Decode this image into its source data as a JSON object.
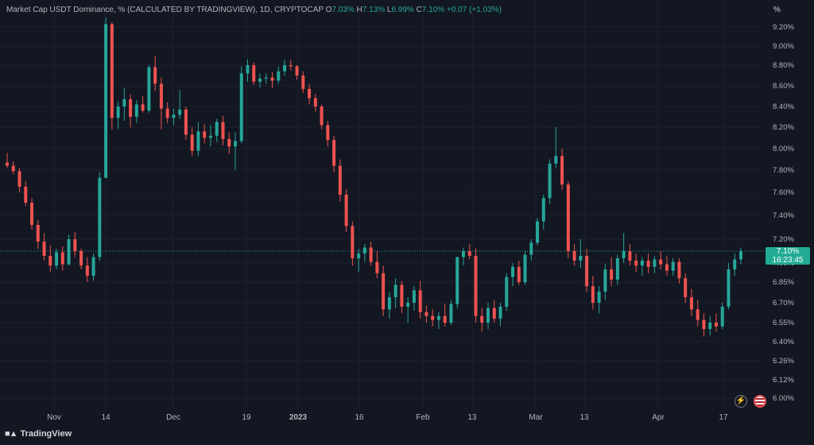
{
  "legend": {
    "title": "Market Cap USDT Dominance, % (CALCULATED BY TRADINGVIEW), 1D, CRYPTOCAP",
    "o_label": "O",
    "o_val": "7.03%",
    "h_label": "H",
    "h_val": "7.13%",
    "l_label": "L",
    "l_val": "6.99%",
    "c_label": "C",
    "c_val": "7.10%",
    "change": "+0.07 (+1.03%)"
  },
  "price_axis_unit": "%",
  "last_price": "7.10%",
  "countdown": "16:23:45",
  "brand": "TradingView",
  "colors": {
    "up": "#26a69a",
    "down": "#ef5350",
    "bg": "#131722",
    "grid": "#1e222d",
    "last": "#22ab94"
  },
  "icons": {
    "lightning": "lightning-icon",
    "flag": "us-flag-icon"
  },
  "chart_data": {
    "type": "candlestick",
    "y_ticks": [
      "9.20%",
      "9.00%",
      "8.80%",
      "8.60%",
      "8.40%",
      "8.20%",
      "8.00%",
      "7.80%",
      "7.60%",
      "7.40%",
      "7.20%",
      "7.00%",
      "6.85%",
      "6.70%",
      "6.55%",
      "6.40%",
      "6.26%",
      "6.12%",
      "6.00%"
    ],
    "x_ticks": [
      "Nov",
      "14",
      "Dec",
      "19",
      "2023",
      "16",
      "Feb",
      "13",
      "Mar",
      "13",
      "Apr",
      "17"
    ],
    "last_value": 7.1,
    "ohlc": [
      [
        7.87,
        7.96,
        7.82,
        7.84
      ],
      [
        7.84,
        7.88,
        7.76,
        7.79
      ],
      [
        7.79,
        7.82,
        7.6,
        7.65
      ],
      [
        7.65,
        7.7,
        7.48,
        7.51
      ],
      [
        7.51,
        7.55,
        7.28,
        7.32
      ],
      [
        7.32,
        7.36,
        7.12,
        7.18
      ],
      [
        7.18,
        7.25,
        7.02,
        7.06
      ],
      [
        7.06,
        7.15,
        6.93,
        6.98
      ],
      [
        6.98,
        7.12,
        6.95,
        7.09
      ],
      [
        7.09,
        7.14,
        6.94,
        6.99
      ],
      [
        6.99,
        7.24,
        6.98,
        7.2
      ],
      [
        7.2,
        7.26,
        7.05,
        7.1
      ],
      [
        7.1,
        7.12,
        6.95,
        6.98
      ],
      [
        6.98,
        7.05,
        6.85,
        6.9
      ],
      [
        6.9,
        7.08,
        6.86,
        7.05
      ],
      [
        7.05,
        7.78,
        7.02,
        7.73
      ],
      [
        7.73,
        9.3,
        7.73,
        9.23
      ],
      [
        9.23,
        9.25,
        8.18,
        8.29
      ],
      [
        8.29,
        8.45,
        8.18,
        8.4
      ],
      [
        8.4,
        8.58,
        8.26,
        8.47
      ],
      [
        8.47,
        8.52,
        8.2,
        8.3
      ],
      [
        8.3,
        8.46,
        8.24,
        8.42
      ],
      [
        8.42,
        8.5,
        8.34,
        8.36
      ],
      [
        8.36,
        8.8,
        8.34,
        8.78
      ],
      [
        8.78,
        8.9,
        8.55,
        8.62
      ],
      [
        8.62,
        8.68,
        8.18,
        8.38
      ],
      [
        8.38,
        8.44,
        8.24,
        8.29
      ],
      [
        8.29,
        8.38,
        8.22,
        8.32
      ],
      [
        8.32,
        8.56,
        8.28,
        8.37
      ],
      [
        8.37,
        8.4,
        8.08,
        8.13
      ],
      [
        8.13,
        8.2,
        7.93,
        7.98
      ],
      [
        7.98,
        8.25,
        7.93,
        8.16
      ],
      [
        8.16,
        8.23,
        8.05,
        8.1
      ],
      [
        8.1,
        8.22,
        8.02,
        8.12
      ],
      [
        8.12,
        8.28,
        8.06,
        8.25
      ],
      [
        8.25,
        8.31,
        8.03,
        8.09
      ],
      [
        8.09,
        8.15,
        7.95,
        8.02
      ],
      [
        8.02,
        8.15,
        7.8,
        8.07
      ],
      [
        8.07,
        8.79,
        8.05,
        8.72
      ],
      [
        8.72,
        8.86,
        8.64,
        8.8
      ],
      [
        8.8,
        8.83,
        8.61,
        8.64
      ],
      [
        8.64,
        8.72,
        8.58,
        8.67
      ],
      [
        8.67,
        8.72,
        8.62,
        8.68
      ],
      [
        8.68,
        8.73,
        8.58,
        8.65
      ],
      [
        8.65,
        8.79,
        8.62,
        8.74
      ],
      [
        8.74,
        8.86,
        8.7,
        8.8
      ],
      [
        8.8,
        8.86,
        8.75,
        8.79
      ],
      [
        8.79,
        8.8,
        8.66,
        8.7
      ],
      [
        8.7,
        8.74,
        8.53,
        8.57
      ],
      [
        8.57,
        8.62,
        8.42,
        8.48
      ],
      [
        8.48,
        8.52,
        8.35,
        8.4
      ],
      [
        8.4,
        8.42,
        8.18,
        8.22
      ],
      [
        8.22,
        8.26,
        8.02,
        8.08
      ],
      [
        8.08,
        8.12,
        7.78,
        7.84
      ],
      [
        7.84,
        7.9,
        7.52,
        7.58
      ],
      [
        7.58,
        7.63,
        7.26,
        7.31
      ],
      [
        7.31,
        7.35,
        6.98,
        7.04
      ],
      [
        7.04,
        7.12,
        6.93,
        7.08
      ],
      [
        7.08,
        7.16,
        7.01,
        7.13
      ],
      [
        7.13,
        7.18,
        6.98,
        7.01
      ],
      [
        7.01,
        7.1,
        6.88,
        6.92
      ],
      [
        6.92,
        6.98,
        6.6,
        6.65
      ],
      [
        6.65,
        6.78,
        6.58,
        6.74
      ],
      [
        6.74,
        6.88,
        6.66,
        6.83
      ],
      [
        6.83,
        6.86,
        6.62,
        6.67
      ],
      [
        6.67,
        6.74,
        6.55,
        6.7
      ],
      [
        6.7,
        6.82,
        6.64,
        6.79
      ],
      [
        6.79,
        6.86,
        6.58,
        6.63
      ],
      [
        6.63,
        6.68,
        6.55,
        6.6
      ],
      [
        6.6,
        6.65,
        6.52,
        6.57
      ],
      [
        6.57,
        6.63,
        6.5,
        6.6
      ],
      [
        6.6,
        6.69,
        6.52,
        6.55
      ],
      [
        6.55,
        6.72,
        6.53,
        6.69
      ],
      [
        6.69,
        6.95,
        6.66,
        7.05
      ],
      [
        7.05,
        7.13,
        6.98,
        7.1
      ],
      [
        7.1,
        7.16,
        7.03,
        7.06
      ],
      [
        7.06,
        7.12,
        6.55,
        6.6
      ],
      [
        6.6,
        6.66,
        6.48,
        6.55
      ],
      [
        6.55,
        6.7,
        6.5,
        6.66
      ],
      [
        6.66,
        6.72,
        6.55,
        6.58
      ],
      [
        6.58,
        6.7,
        6.52,
        6.67
      ],
      [
        6.67,
        6.92,
        6.64,
        6.89
      ],
      [
        6.89,
        7.0,
        6.82,
        6.97
      ],
      [
        6.97,
        7.02,
        6.83,
        6.85
      ],
      [
        6.85,
        7.1,
        6.83,
        7.07
      ],
      [
        7.07,
        7.2,
        7.02,
        7.17
      ],
      [
        7.17,
        7.38,
        7.15,
        7.35
      ],
      [
        7.35,
        7.58,
        7.28,
        7.55
      ],
      [
        7.55,
        7.9,
        7.5,
        7.86
      ],
      [
        7.86,
        8.2,
        7.82,
        7.93
      ],
      [
        7.93,
        8.0,
        7.62,
        7.67
      ],
      [
        7.67,
        7.7,
        7.04,
        7.1
      ],
      [
        7.1,
        7.16,
        6.98,
        7.02
      ],
      [
        7.02,
        7.2,
        6.96,
        7.06
      ],
      [
        7.06,
        7.12,
        6.78,
        6.82
      ],
      [
        6.82,
        6.9,
        6.65,
        6.7
      ],
      [
        6.7,
        6.82,
        6.62,
        6.78
      ],
      [
        6.78,
        6.99,
        6.72,
        6.95
      ],
      [
        6.95,
        7.05,
        6.82,
        6.87
      ],
      [
        6.87,
        7.07,
        6.83,
        7.04
      ],
      [
        7.04,
        7.25,
        7.0,
        7.1
      ],
      [
        7.1,
        7.16,
        6.98,
        7.02
      ],
      [
        7.02,
        7.08,
        6.93,
        6.98
      ],
      [
        6.98,
        7.05,
        6.9,
        7.02
      ],
      [
        7.02,
        7.08,
        6.92,
        6.97
      ],
      [
        6.97,
        7.06,
        6.92,
        7.03
      ],
      [
        7.03,
        7.1,
        6.95,
        6.99
      ],
      [
        6.99,
        7.06,
        6.9,
        6.94
      ],
      [
        6.94,
        7.04,
        6.9,
        7.01
      ],
      [
        7.01,
        7.04,
        6.84,
        6.88
      ],
      [
        6.88,
        6.92,
        6.7,
        6.74
      ],
      [
        6.74,
        6.8,
        6.6,
        6.65
      ],
      [
        6.65,
        6.72,
        6.52,
        6.57
      ],
      [
        6.57,
        6.62,
        6.44,
        6.5
      ],
      [
        6.5,
        6.6,
        6.45,
        6.55
      ],
      [
        6.55,
        6.62,
        6.48,
        6.52
      ],
      [
        6.52,
        6.7,
        6.5,
        6.67
      ],
      [
        6.67,
        7.0,
        6.65,
        6.95
      ],
      [
        6.95,
        7.08,
        6.9,
        7.03
      ],
      [
        7.03,
        7.13,
        6.99,
        7.1
      ]
    ]
  }
}
